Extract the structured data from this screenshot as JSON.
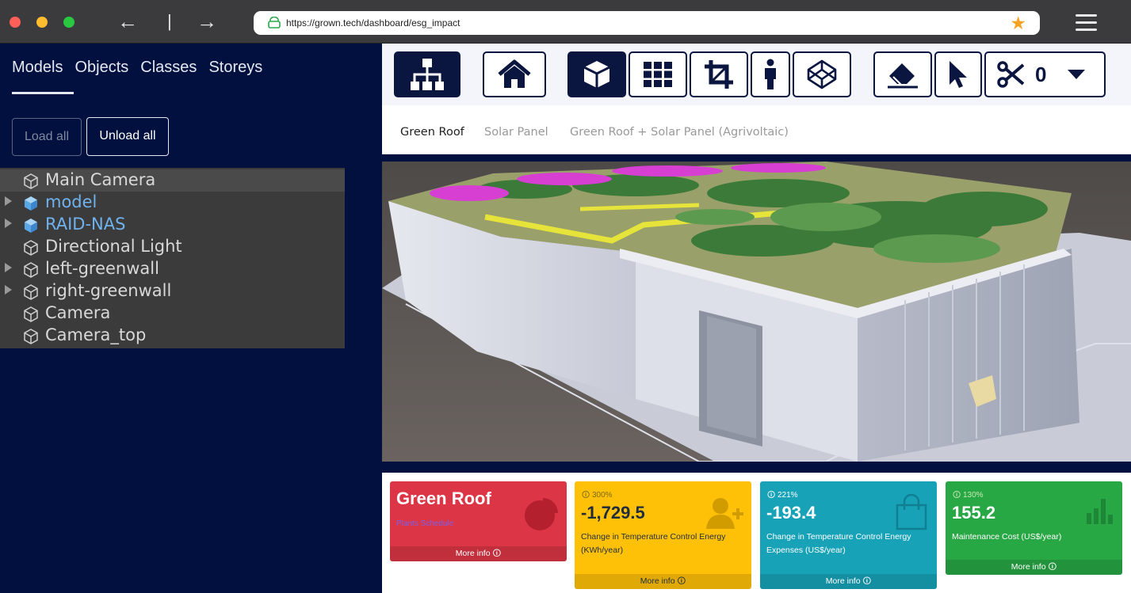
{
  "browser": {
    "url": "https://grown.tech/dashboard/esg_impact"
  },
  "left_panel": {
    "tabs": [
      "Models",
      "Objects",
      "Classes",
      "Storeys"
    ],
    "load_all": "Load all",
    "unload_all": "Unload all",
    "tree": [
      {
        "label": "Main Camera"
      },
      {
        "label": "model"
      },
      {
        "label": "RAID-NAS"
      },
      {
        "label": "Directional Light"
      },
      {
        "label": "left-greenwall"
      },
      {
        "label": "right-greenwall"
      },
      {
        "label": "Camera"
      },
      {
        "label": "Camera_top"
      }
    ]
  },
  "toolbar": {
    "cut_count": "0"
  },
  "subtabs": [
    "Green Roof",
    "Solar Panel",
    "Green Roof + Solar Panel (Agrivoltaic)"
  ],
  "cards": {
    "green_roof": {
      "title": "Green Roof",
      "link": "Plants Schedule",
      "more": "More info 🛈"
    },
    "energy": {
      "pct": "🛈 300%",
      "value": "-1,729.5",
      "label": "Change in Temperature Control Energy (KWh/year)",
      "more": "More info 🛈"
    },
    "expenses": {
      "pct": "🛈 221%",
      "value": "-193.4",
      "label": "Change in Temperature Control Energy Expenses (US$/year)",
      "more": "More info 🛈"
    },
    "maintenance": {
      "pct": "🛈 130%",
      "value": "155.2",
      "label": "Maintenance Cost (US$/year)",
      "more": "More info 🛈"
    }
  },
  "colors": {
    "red": "#dc3545",
    "yellow": "#ffc107",
    "teal": "#17a2b8",
    "green": "#28a745",
    "navy": "#02103f"
  }
}
